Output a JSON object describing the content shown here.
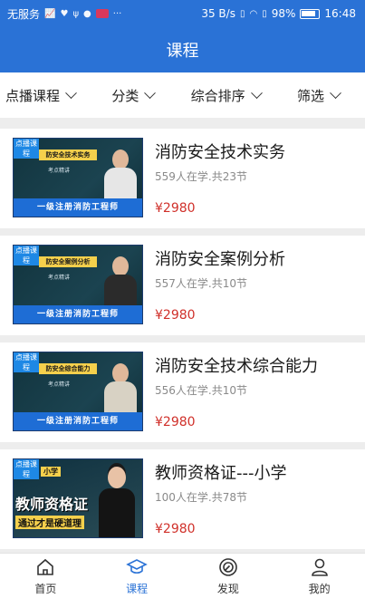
{
  "status_bar": {
    "carrier": "无服务",
    "speed": "35 B/s",
    "battery": "98%",
    "time": "16:48"
  },
  "header": {
    "title": "课程"
  },
  "filters": [
    {
      "label": "点播课程"
    },
    {
      "label": "分类"
    },
    {
      "label": "综合排序"
    },
    {
      "label": "筛选"
    }
  ],
  "courses": [
    {
      "title": "消防安全技术实务",
      "meta": "559人在学.共23节",
      "price": "¥2980",
      "thumb_tag": "点播课程",
      "thumb_name": "防安全技术实务",
      "thumb_sub": "考点精讲",
      "thumb_banner": "一级注册消防工程师"
    },
    {
      "title": "消防安全案例分析",
      "meta": "557人在学.共10节",
      "price": "¥2980",
      "thumb_tag": "点播课程",
      "thumb_name": "防安全案例分析",
      "thumb_sub": "考点精讲",
      "thumb_banner": "一级注册消防工程师"
    },
    {
      "title": "消防安全技术综合能力",
      "meta": "556人在学.共10节",
      "price": "¥2980",
      "thumb_tag": "点播课程",
      "thumb_name": "防安全综合能力",
      "thumb_sub": "考点精讲",
      "thumb_banner": "一级注册消防工程师"
    },
    {
      "title": "教师资格证---小学",
      "meta": "100人在学.共78节",
      "price": "¥2980",
      "thumb_tag": "点播课程",
      "thumb_mini": "小学",
      "thumb_big": "教师资格证",
      "thumb_yellow": "通过才是硬道理"
    }
  ],
  "tabs": [
    {
      "label": "首页",
      "icon": "home-icon"
    },
    {
      "label": "课程",
      "icon": "course-cap-icon",
      "active": true
    },
    {
      "label": "发现",
      "icon": "discover-compass-icon"
    },
    {
      "label": "我的",
      "icon": "profile-icon"
    }
  ],
  "colors": {
    "brand": "#2a72d6",
    "price": "#d0302a"
  }
}
